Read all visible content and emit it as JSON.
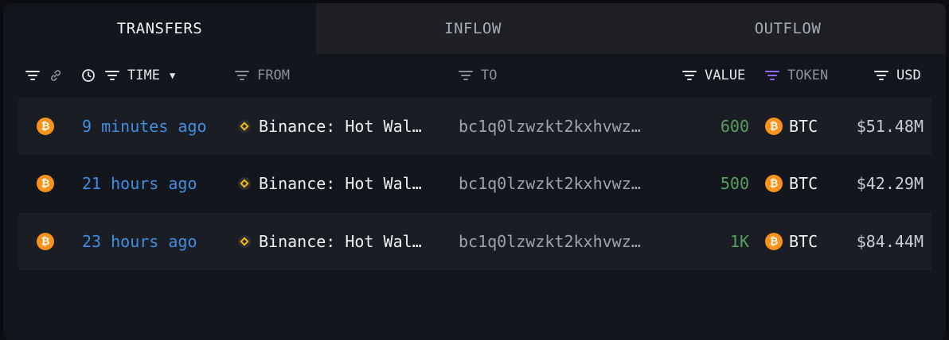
{
  "tabs": [
    {
      "label": "TRANSFERS",
      "active": true
    },
    {
      "label": "INFLOW",
      "active": false
    },
    {
      "label": "OUTFLOW",
      "active": false
    }
  ],
  "columns": {
    "time": "TIME",
    "from": "FROM",
    "to": "TO",
    "value": "VALUE",
    "token": "TOKEN",
    "usd": "USD"
  },
  "colors": {
    "time_link": "#3f8de0",
    "value_green": "#55a05e",
    "btc_orange": "#f7931a",
    "token_filter_active": "#8e6bf0"
  },
  "rows": [
    {
      "icon": "btc-icon",
      "time": "9 minutes ago",
      "from": "Binance: Hot Wal…",
      "to": "bc1q0lzwzkt2kxhvwz…",
      "value": "600",
      "token": "BTC",
      "usd": "$51.48M"
    },
    {
      "icon": "btc-icon",
      "time": "21 hours ago",
      "from": "Binance: Hot Wal…",
      "to": "bc1q0lzwzkt2kxhvwz…",
      "value": "500",
      "token": "BTC",
      "usd": "$42.29M"
    },
    {
      "icon": "btc-icon",
      "time": "23 hours ago",
      "from": "Binance: Hot Wal…",
      "to": "bc1q0lzwzkt2kxhvwz…",
      "value": "1K",
      "token": "BTC",
      "usd": "$84.44M"
    }
  ]
}
